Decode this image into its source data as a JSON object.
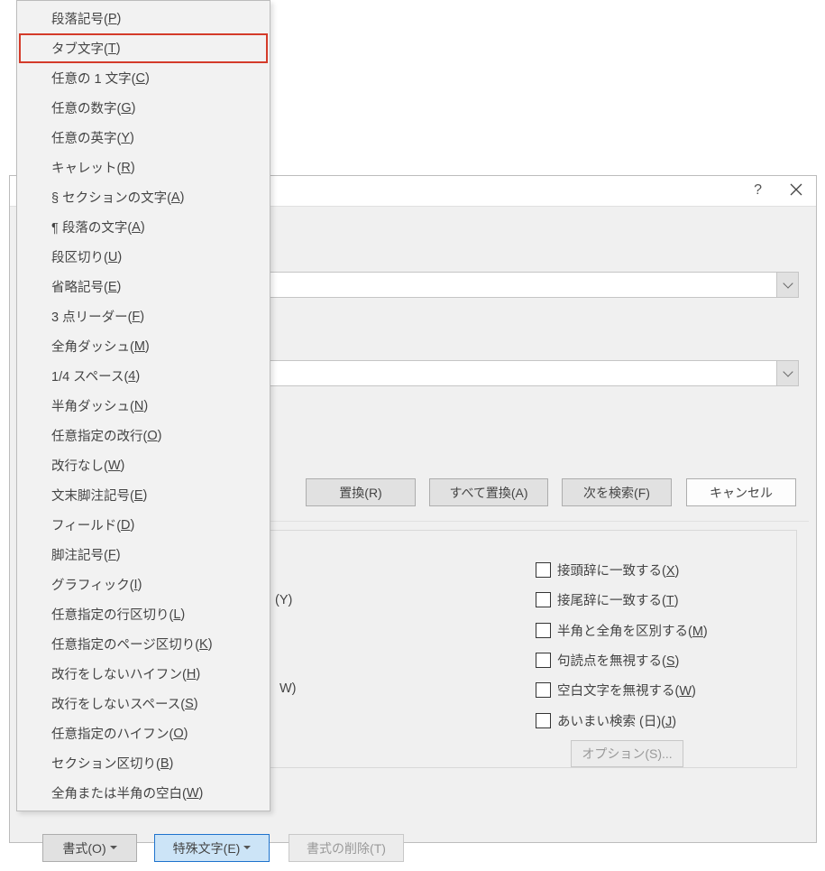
{
  "dialog": {
    "help_icon": "?",
    "fields": {
      "find_value": "",
      "replace_value": ""
    },
    "buttons": {
      "replace": "置換(R)",
      "replace_all": "すべて置換(A)",
      "find_next": "次を検索(F)",
      "cancel": "キャンセル",
      "format": "書式(O)",
      "special": "特殊文字(E)",
      "clear": "書式の削除(T)",
      "options": "オプション(S)..."
    },
    "peek": {
      "y_tail": "(Y)",
      "w_tail": "W)"
    },
    "options": {
      "prefix": {
        "label": "接頭辞に一致する(",
        "acc": "X",
        "tail": ")"
      },
      "suffix": {
        "label": "接尾辞に一致する(",
        "acc": "T",
        "tail": ")"
      },
      "width": {
        "label": "半角と全角を区別する(",
        "acc": "M",
        "tail": ")"
      },
      "punct": {
        "label": "句読点を無視する(",
        "acc": "S",
        "tail": ")"
      },
      "whitespace": {
        "label": "空白文字を無視する(",
        "acc": "W",
        "tail": ")"
      },
      "fuzzy": {
        "label": "あいまい検索 (日)(",
        "acc": "J",
        "tail": ")"
      }
    }
  },
  "menu": {
    "items": [
      {
        "label": "段落記号(",
        "acc": "P",
        "tail": ")"
      },
      {
        "label": "タブ文字(",
        "acc": "T",
        "tail": ")",
        "highlight": true
      },
      {
        "label": "任意の 1 文字(",
        "acc": "C",
        "tail": ")"
      },
      {
        "label": "任意の数字(",
        "acc": "G",
        "tail": ")"
      },
      {
        "label": "任意の英字(",
        "acc": "Y",
        "tail": ")"
      },
      {
        "label": "キャレット(",
        "acc": "R",
        "tail": ")"
      },
      {
        "label": "§ セクションの文字(",
        "acc": "A",
        "tail": ")"
      },
      {
        "label": "¶ 段落の文字(",
        "acc": "A",
        "tail": ")"
      },
      {
        "label": "段区切り(",
        "acc": "U",
        "tail": ")"
      },
      {
        "label": "省略記号(",
        "acc": "E",
        "tail": ")"
      },
      {
        "label": "3 点リーダー(",
        "acc": "F",
        "tail": ")"
      },
      {
        "label": "全角ダッシュ(",
        "acc": "M",
        "tail": ")"
      },
      {
        "label": "1/4 スペース(",
        "acc": "4",
        "tail": ")"
      },
      {
        "label": "半角ダッシュ(",
        "acc": "N",
        "tail": ")"
      },
      {
        "label": "任意指定の改行(",
        "acc": "O",
        "tail": ")"
      },
      {
        "label": "改行なし(",
        "acc": "W",
        "tail": ")"
      },
      {
        "label": "文末脚注記号(",
        "acc": "E",
        "tail": ")"
      },
      {
        "label": "フィールド(",
        "acc": "D",
        "tail": ")"
      },
      {
        "label": "脚注記号(",
        "acc": "F",
        "tail": ")"
      },
      {
        "label": "グラフィック(",
        "acc": "I",
        "tail": ")"
      },
      {
        "label": "任意指定の行区切り(",
        "acc": "L",
        "tail": ")"
      },
      {
        "label": "任意指定のページ区切り(",
        "acc": "K",
        "tail": ")"
      },
      {
        "label": "改行をしないハイフン(",
        "acc": "H",
        "tail": ")"
      },
      {
        "label": "改行をしないスペース(",
        "acc": "S",
        "tail": ")"
      },
      {
        "label": "任意指定のハイフン(",
        "acc": "O",
        "tail": ")"
      },
      {
        "label": "セクション区切り(",
        "acc": "B",
        "tail": ")"
      },
      {
        "label": "全角または半角の空白(",
        "acc": "W",
        "tail": ")"
      }
    ]
  }
}
